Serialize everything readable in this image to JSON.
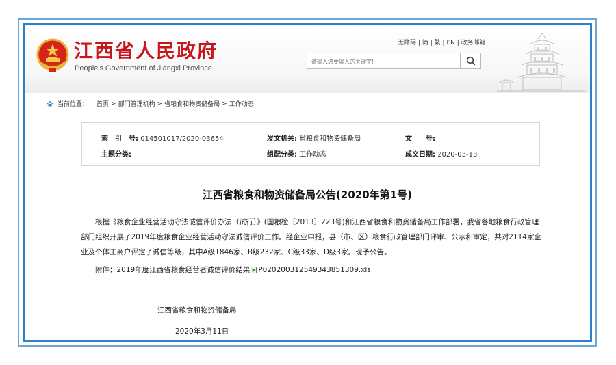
{
  "header": {
    "site_title": "江西省人民政府",
    "site_subtitle": "People's Government of Jiangxi Province",
    "top_links": [
      "无障碍",
      "简",
      "繁",
      "EN",
      "政务邮箱"
    ],
    "search": {
      "placeholder": "请输入您要输入的关键字!"
    }
  },
  "breadcrumb": {
    "label": "当前位置：",
    "items": [
      "首页",
      "部门管理机构",
      "省粮食和物资储备局",
      "工作动态"
    ],
    "separator": ">"
  },
  "info": {
    "index_no": {
      "key": "索　引　号:",
      "value": "014501017/2020-03654"
    },
    "issuer": {
      "key": "发文机关:",
      "value": "省粮食和物资储备局"
    },
    "doc_no": {
      "key": "文　　号:",
      "value": ""
    },
    "topic": {
      "key": "主题分类:",
      "value": ""
    },
    "category": {
      "key": "组配分类:",
      "value": "工作动态"
    },
    "date": {
      "key": "成文日期:",
      "value": "2020-03-13"
    }
  },
  "article": {
    "title": "江西省粮食和物资储备局公告(2020年第1号)",
    "body": "根据《粮食企业经营活动守法诚信评价办法（试行）》(国粮检〔2013〕223号)和江西省粮食和物资储备局工作部署，我省各地粮食行政管理部门组织开展了2019年度粮食企业经营活动守法诚信评价工作。经企业申报，县（市、区）粮食行政管理部门评审、公示和审定，共对2114家企业及个体工商户评定了诚信等级，其中A级1846家、B级232家、C级33家、D级3家。现予公告。",
    "attachment_label": "附件：2019年度江西省粮食经营者诚信评价结果",
    "attachment_file": "P020200312549343851309.xls",
    "signer": "江西省粮食和物资储备局",
    "date": "2020年3月11日"
  },
  "colors": {
    "brand_red": "#c8161d",
    "frame_blue": "#2f7fc4",
    "frame_light_blue": "#6aa6d6"
  },
  "icons": [
    "national-emblem-icon",
    "search-icon",
    "home-icon",
    "xls-file-icon",
    "pagoda-illustration"
  ]
}
